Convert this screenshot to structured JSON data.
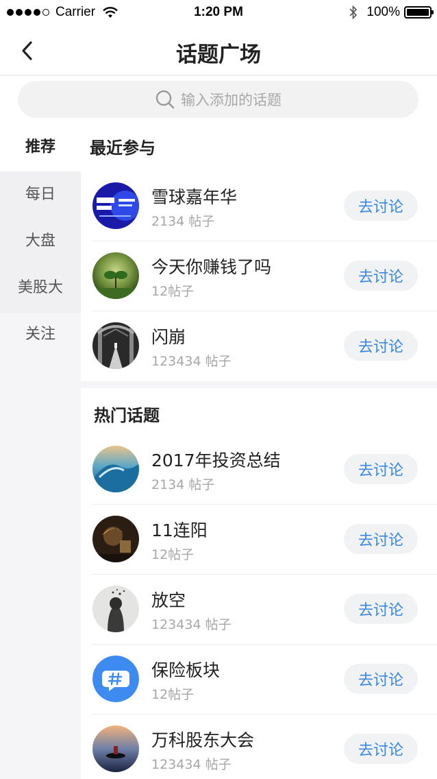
{
  "status_bar": {
    "carrier": "Carrier",
    "time": "1:20 PM",
    "battery": "100%"
  },
  "nav": {
    "title": "话题广场",
    "back_icon": "chevron-left-icon"
  },
  "search": {
    "placeholder": "输入添加的话题",
    "icon": "search-icon"
  },
  "sidebar": {
    "items": [
      {
        "label": "推荐",
        "active": true
      },
      {
        "label": "每日",
        "active": false
      },
      {
        "label": "大盘",
        "active": false
      },
      {
        "label": "美股大",
        "active": false
      },
      {
        "label": "关注",
        "active": false
      }
    ]
  },
  "sections": {
    "recent": {
      "title": "最近参与",
      "rows": [
        {
          "title": "雪球嘉年华",
          "count": "2134 帖子",
          "button": "去讨论"
        },
        {
          "title": "今天你赚钱了吗",
          "count": "12帖子",
          "button": "去讨论"
        },
        {
          "title": "闪崩",
          "count": "123434 帖子",
          "button": "去讨论"
        }
      ]
    },
    "hot": {
      "title": "热门话题",
      "rows": [
        {
          "title": "2017年投资总结",
          "count": "2134 帖子",
          "button": "去讨论"
        },
        {
          "title": "11连阳",
          "count": "12帖子",
          "button": "去讨论"
        },
        {
          "title": "放空",
          "count": "123434 帖子",
          "button": "去讨论"
        },
        {
          "title": "保险板块",
          "count": "12帖子",
          "button": "去讨论"
        },
        {
          "title": "万科股东大会",
          "count": "123434 帖子",
          "button": "去讨论"
        }
      ]
    }
  },
  "colors": {
    "accent": "#3a87e0",
    "sidebar_bg": "#f5f5f7",
    "button_bg": "#f1f2f4"
  }
}
